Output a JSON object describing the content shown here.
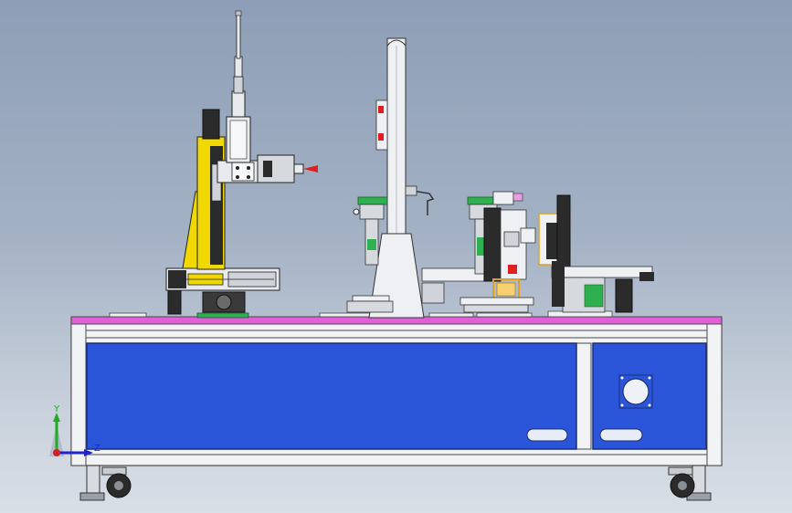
{
  "viewport": {
    "background_top": "#8d9eb6",
    "background_bottom": "#d9dfe7"
  },
  "colors": {
    "frame_white": "#f2f3f5",
    "frame_edge": "#4a4a4a",
    "table_top": "#e060d8",
    "panel_blue": "#2a55d8",
    "robot_yellow": "#f0d800",
    "accent_green": "#1f9a3a",
    "accent_red": "#e02020",
    "machine_dark": "#2b2b2b",
    "machine_grey": "#c8ccd2",
    "bracket_orange": "#e0a020"
  },
  "triad": {
    "y_label": "Y",
    "z_label": "Z",
    "y_color": "#22aa22",
    "z_color": "#2222cc"
  }
}
